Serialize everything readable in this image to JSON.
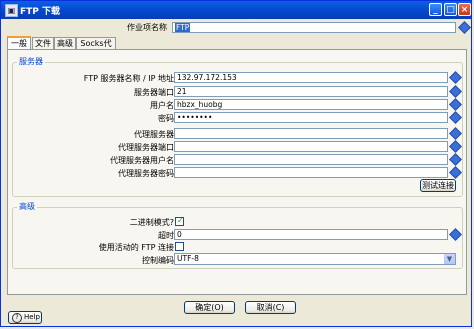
{
  "window": {
    "title": "FTP 下载",
    "minimize": "_",
    "maximize": "□",
    "close": "×"
  },
  "job": {
    "label": "作业项名称",
    "value": "FTP"
  },
  "tabs": [
    "一般",
    "文件",
    "高级",
    "Socks代理"
  ],
  "server_group": {
    "title": "服务器",
    "fields": [
      {
        "label": "FTP 服务器名称 / IP 地址",
        "value": "132.97.172.153"
      },
      {
        "label": "服务器端口",
        "value": "21"
      },
      {
        "label": "用户名",
        "value": "hbzx_huobg"
      },
      {
        "label": "密码",
        "value": "••••••••"
      },
      {
        "label": "代理服务器",
        "value": ""
      },
      {
        "label": "代理服务器端口",
        "value": ""
      },
      {
        "label": "代理服务器用户名",
        "value": ""
      },
      {
        "label": "代理服务器密码",
        "value": ""
      }
    ],
    "test_button": "测试连接"
  },
  "advanced_group": {
    "title": "高级",
    "binary_label": "二进制模式?",
    "timeout_label": "超时",
    "timeout_value": "0",
    "active_label": "使用活动的 FTP 连接",
    "encoding_label": "控制编码",
    "encoding_value": "UTF-8"
  },
  "buttons": {
    "ok": "确定(O)",
    "cancel": "取消(C)",
    "help": "Help"
  }
}
